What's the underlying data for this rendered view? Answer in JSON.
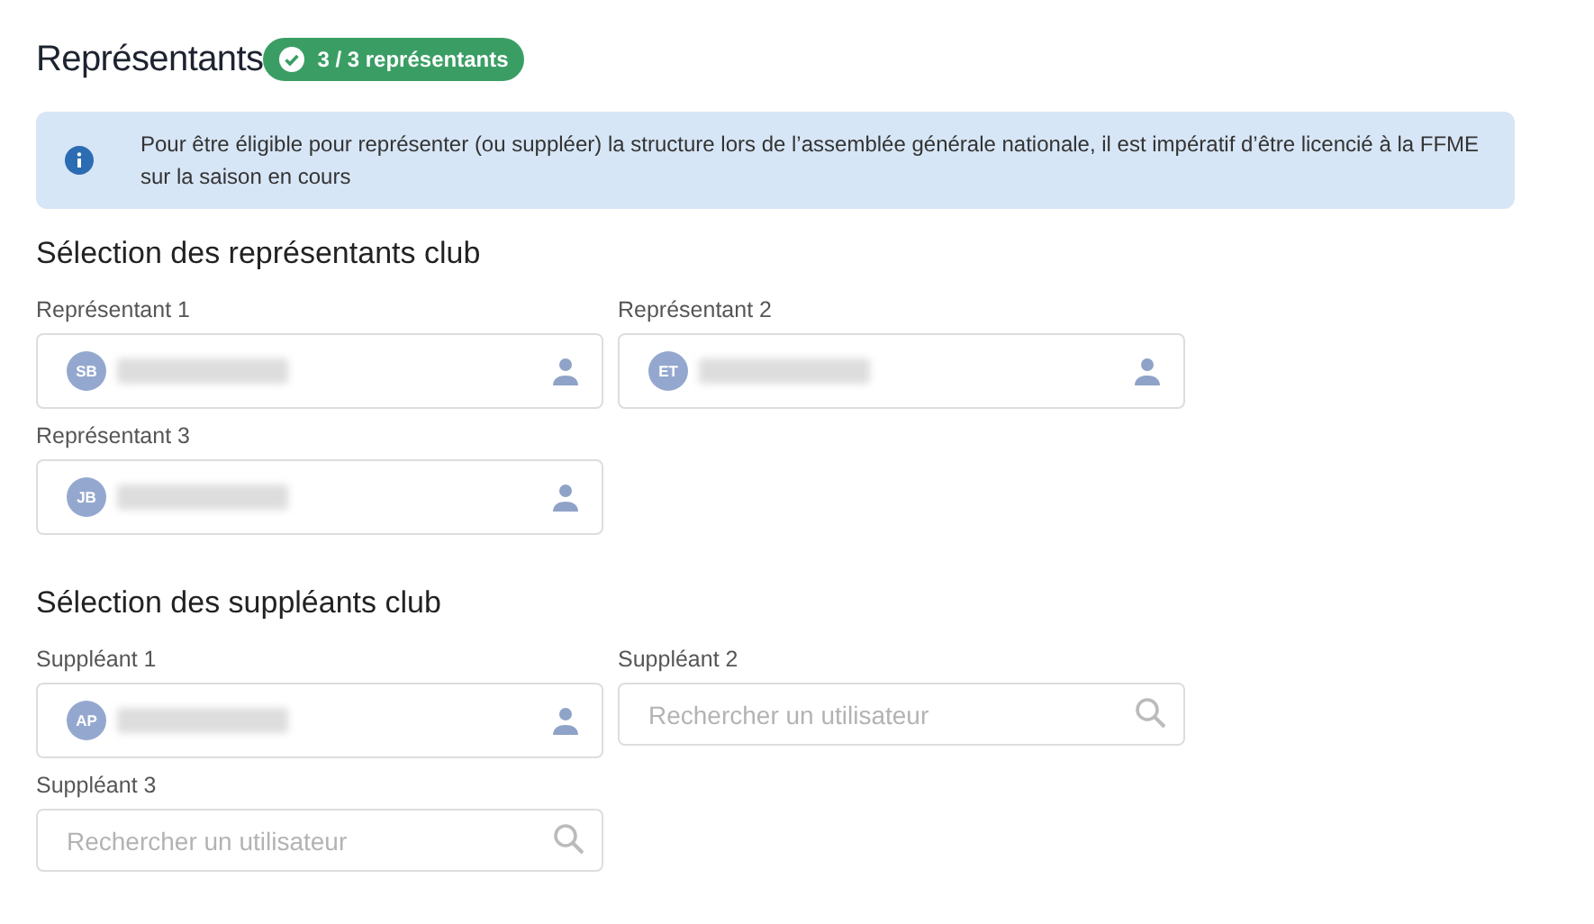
{
  "title": "Représentants",
  "badge": {
    "text": "3 / 3 représentants",
    "complete": true
  },
  "info": "Pour être éligible pour représenter (ou suppléer) la structure lors de l’assemblée générale nationale, il est impératif d’être licencié à la FFME sur la saison en cours",
  "sections": [
    {
      "heading": "Sélection des représentants club",
      "fields": [
        {
          "label": "Représentant 1",
          "kind": "user",
          "initials": "SB"
        },
        {
          "label": "Représentant 2",
          "kind": "user",
          "initials": "ET"
        },
        {
          "label": "Représentant 3",
          "kind": "user",
          "initials": "JB"
        }
      ]
    },
    {
      "heading": "Sélection des suppléants club",
      "fields": [
        {
          "label": "Suppléant 1",
          "kind": "user",
          "initials": "AP"
        },
        {
          "label": "Suppléant 2",
          "kind": "search",
          "placeholder": "Rechercher un utilisateur"
        },
        {
          "label": "Suppléant 3",
          "kind": "search",
          "placeholder": "Rechercher un utilisateur"
        }
      ]
    }
  ]
}
